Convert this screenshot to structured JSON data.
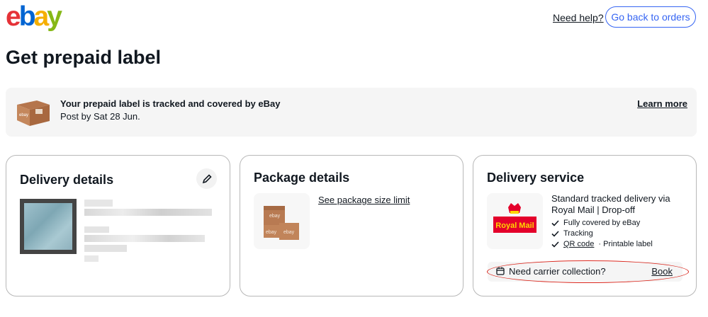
{
  "header": {
    "logo_letters": [
      "e",
      "b",
      "a",
      "y"
    ],
    "need_help": "Need help?",
    "back_button": "Go back to orders"
  },
  "page_title": "Get prepaid label",
  "banner": {
    "icon": "ebay-box-icon",
    "title": "Your prepaid label is tracked and covered by eBay",
    "subtitle": "Post by Sat 28 Jun.",
    "learn_more": "Learn more"
  },
  "delivery_details": {
    "title": "Delivery details",
    "edit_icon": "pencil-icon"
  },
  "package_details": {
    "title": "Package details",
    "size_link": "See package size limit",
    "box_labels": [
      "ebay",
      "ebay",
      "ebay"
    ]
  },
  "delivery_service": {
    "title": "Delivery service",
    "carrier_logo_text": "Royal Mail",
    "service_name": "Standard tracked delivery via Royal Mail | Drop-off",
    "features": [
      "Fully covered by eBay",
      "Tracking"
    ],
    "qr_code": "QR code",
    "qr_suffix": "· Printable label",
    "collection_label": "Need carrier collection?",
    "book": "Book"
  },
  "colors": {
    "accent": "#3665f3",
    "highlight": "#d9261c",
    "royal_mail_red": "#e4002b",
    "royal_mail_yellow": "#ffd500"
  }
}
